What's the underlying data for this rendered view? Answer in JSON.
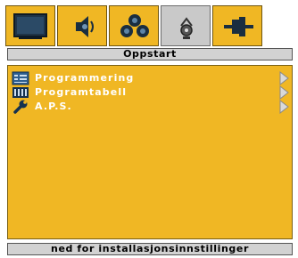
{
  "tabs": [
    {
      "icon": "monitor-icon",
      "active": false
    },
    {
      "icon": "speaker-icon",
      "active": false
    },
    {
      "icon": "channels-icon",
      "active": false
    },
    {
      "icon": "setup-icon",
      "active": true
    },
    {
      "icon": "connector-icon",
      "active": false
    }
  ],
  "header": {
    "title": "Oppstart"
  },
  "menu": {
    "items": [
      {
        "label": "Programmering",
        "icon": "programming-icon",
        "has_submenu": true
      },
      {
        "label": "Programtabell",
        "icon": "program-table-icon",
        "has_submenu": true
      },
      {
        "label": "A.P.S.",
        "icon": "wrench-icon",
        "has_submenu": true
      }
    ]
  },
  "footer": {
    "hint": "ned for installasjonsinnstillinger"
  },
  "colors": {
    "menu_background": "#f0b724",
    "active_tab": "#c9c9c9",
    "bar_background": "#d2d2d2"
  }
}
